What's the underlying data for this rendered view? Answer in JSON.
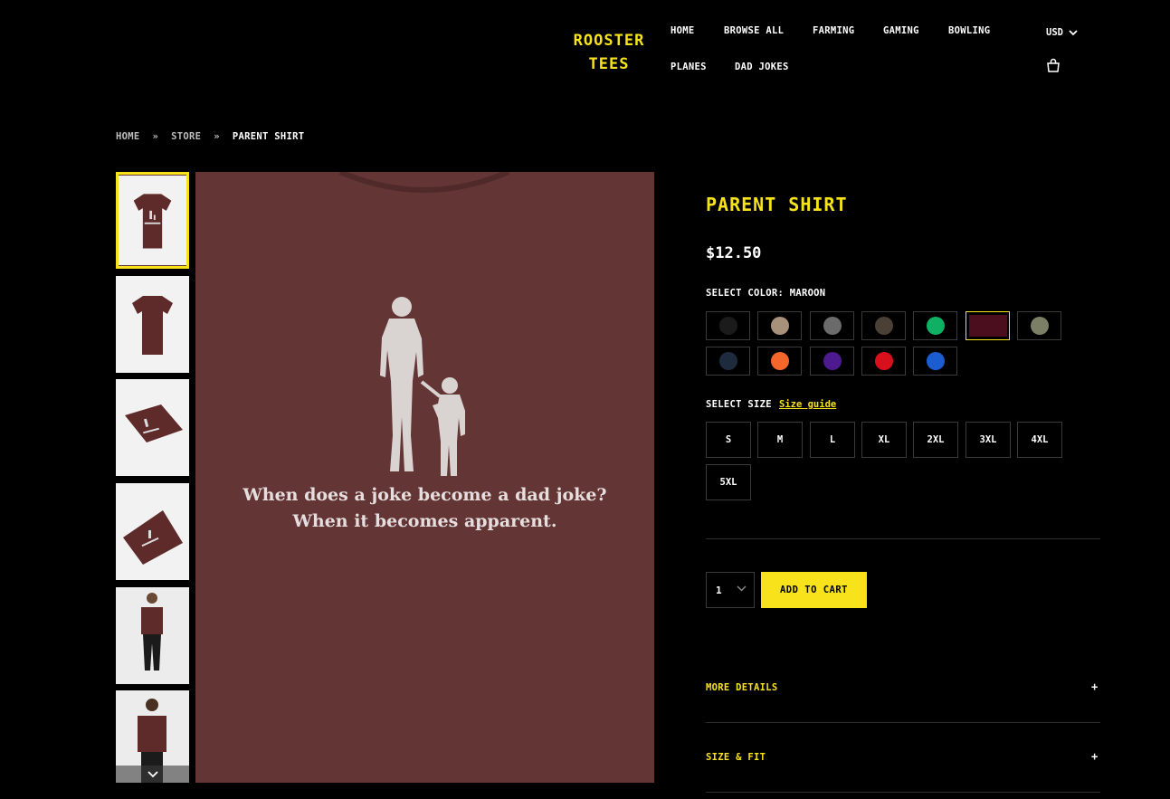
{
  "header": {
    "brand": [
      "ROOSTER",
      "TEES"
    ],
    "nav": [
      "HOME",
      "BROWSE ALL",
      "FARMING",
      "GAMING",
      "BOWLING",
      "PLANES",
      "DAD JOKES"
    ],
    "currency": "USD",
    "icons": [
      "chevron-down-icon",
      "shopping-bag-icon"
    ]
  },
  "breadcrumb": {
    "home": "HOME",
    "store": "STORE",
    "current": "PARENT SHIRT",
    "separator": "»"
  },
  "gallery": {
    "thumbnail_count": 6,
    "active_index": 0,
    "caption": [
      "When does a joke become a dad joke?",
      "When it becomes apparent."
    ]
  },
  "product": {
    "title": "PARENT SHIRT",
    "price": "$12.50",
    "color_label": "SELECT COLOR: MAROON",
    "colors": [
      "#1b1b1b",
      "#a8917a",
      "#6b6b6b",
      "#4a4036",
      "#0fb063",
      "#4a0e1e",
      "#7a7f66",
      "#1e2a3d",
      "#f5662a",
      "#4d1b8f",
      "#d8101c",
      "#1b5dd1"
    ],
    "selected_color_index": 5,
    "size_label": "SELECT SIZE",
    "size_guide": "Size guide",
    "sizes": [
      "S",
      "M",
      "L",
      "XL",
      "2XL",
      "3XL",
      "4XL",
      "5XL"
    ],
    "quantity": "1",
    "add_to_cart": "ADD TO CART",
    "accordion": [
      "MORE DETAILS",
      "SIZE & FIT"
    ],
    "accordion_icon": "+"
  },
  "colors": {
    "accent": "#f7e21b",
    "background": "#000000",
    "shirt": "#633534"
  }
}
